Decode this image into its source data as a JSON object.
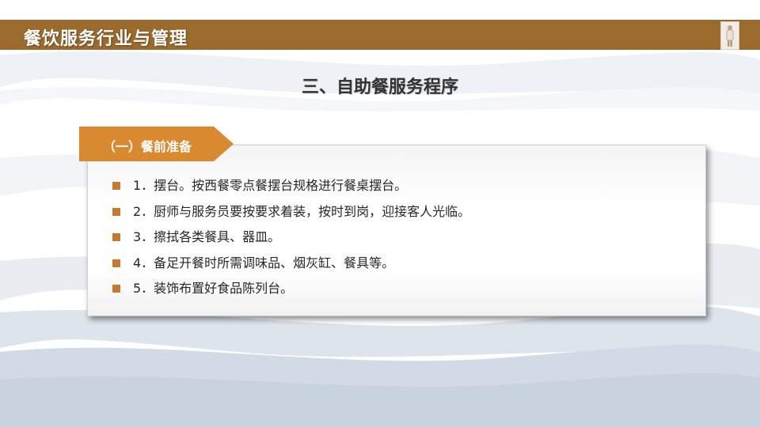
{
  "header": {
    "title": "餐饮服务行业与管理"
  },
  "section": {
    "title": "三、自助餐服务程序"
  },
  "card": {
    "tab_label": "（一）餐前准备",
    "items": [
      "1．摆台。按西餐零点餐摆台规格进行餐桌摆台。",
      "2．厨师与服务员要按要求着装，按时到岗，迎接客人光临。",
      "3．擦拭各类餐具、器皿。",
      "4．备足开餐时所需调味品、烟灰缸、餐具等。",
      "5．装饰布置好食品陈列台。"
    ]
  },
  "colors": {
    "header_bar": "#9b6b2e",
    "tab": "#d9892f",
    "bullet": "#c47a2c",
    "wave": "#c8d3df"
  },
  "icons": {
    "header_thumbnail": "figure-thumbnail-icon",
    "bullet": "square-bullet-icon"
  }
}
